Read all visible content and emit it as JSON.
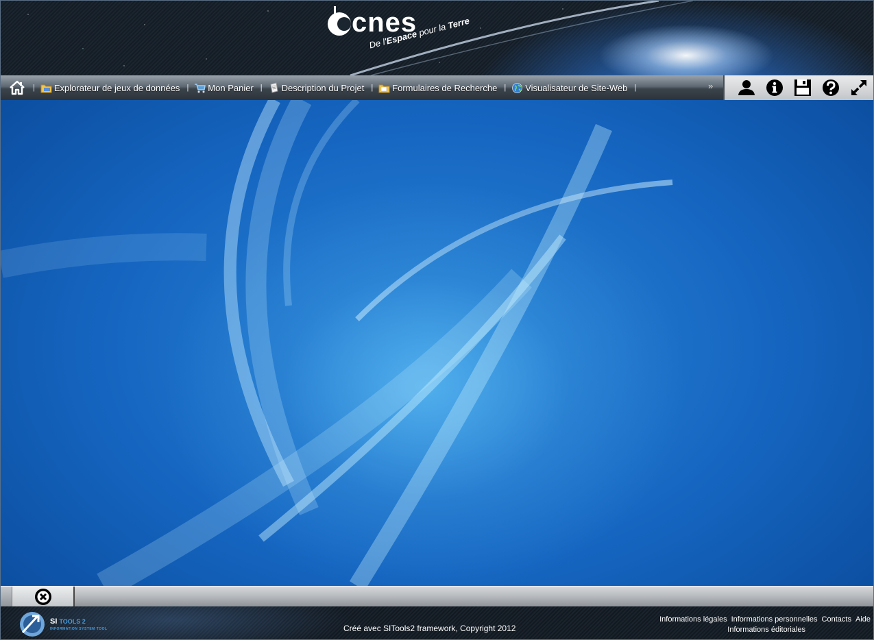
{
  "header": {
    "logo_text": "cnes",
    "tagline_prefix": "De l'",
    "tagline_bold1": "Espace",
    "tagline_mid": " pour la ",
    "tagline_bold2": "Terre"
  },
  "navbar": {
    "items": [
      {
        "label": "Explorateur de jeux de données",
        "icon": "folder-explorer-icon"
      },
      {
        "label": "Mon Panier",
        "icon": "shopping-cart-icon"
      },
      {
        "label": "Description du Projet",
        "icon": "document-icon"
      },
      {
        "label": "Formulaires de Recherche",
        "icon": "folder-search-icon"
      },
      {
        "label": "Visualisateur de Site-Web",
        "icon": "globe-icon"
      }
    ],
    "more_label": "»"
  },
  "tools": [
    "user-icon",
    "info-icon",
    "save-icon",
    "help-icon",
    "fullscreen-icon"
  ],
  "footer": {
    "logo_si": "SI",
    "logo_tools": "TOOLS 2",
    "logo_sub": "INFORMATION SYSTEM TOOL",
    "copyright": "Créé avec SITools2 framework, Copyright 2012",
    "links": {
      "legal": "Informations légales",
      "personal": "Informations personnelles",
      "contacts": "Contacts",
      "help": "Aide",
      "editorial": "Informations éditoriales"
    }
  },
  "colors": {
    "desktop_blue": "#1565c0",
    "accent": "#4b9bd9"
  }
}
